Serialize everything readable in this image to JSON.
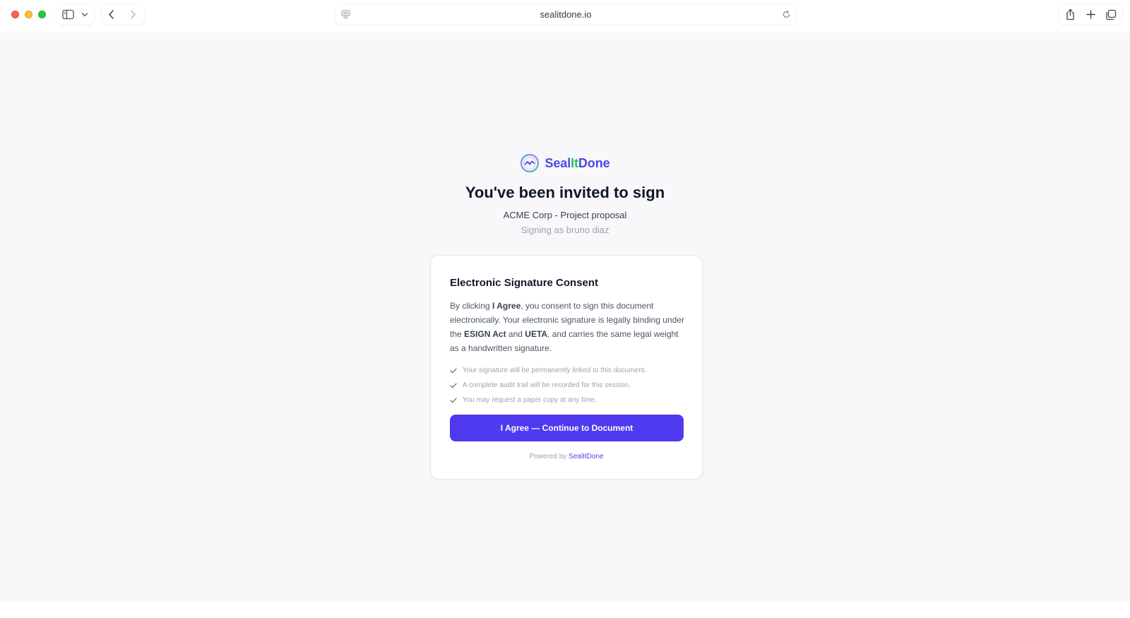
{
  "browser": {
    "url": "sealitdone.io",
    "icons": [
      "sidebar-icon",
      "chevron-down-icon",
      "back-arrow-icon",
      "forward-arrow-icon",
      "reader-icon",
      "reload-icon",
      "share-icon",
      "new-tab-icon",
      "tab-overview-icon"
    ]
  },
  "brand": {
    "name_part1": "Seal",
    "name_part2": "It",
    "name_part3": "Done",
    "colors": {
      "primary": "#4f46e5",
      "secondary": "#22c55e"
    }
  },
  "header": {
    "title": "You've been invited to sign",
    "document_name": "ACME Corp - Project proposal",
    "signer_line": "Signing as bruno diaz"
  },
  "consent": {
    "title": "Electronic Signature Consent",
    "body": {
      "t1": "By clicking ",
      "b1": "I Agree",
      "t2": ", you consent to sign this document electronically. Your electronic signature is legally binding under the ",
      "b2": "ESIGN Act",
      "t3": " and ",
      "b3": "UETA",
      "t4": ", and carries the same legal weight as a handwritten signature."
    },
    "checklist": [
      "Your signature will be permanently linked to this document.",
      "A complete audit trail will be recorded for this session.",
      "You may request a paper copy at any time."
    ],
    "button_label": "I Agree — Continue to Document",
    "powered_by_label": "Powered by",
    "powered_by_link": "SealItDone",
    "colors": {
      "button": "#4f3af0",
      "check": "#9ca3af"
    }
  }
}
